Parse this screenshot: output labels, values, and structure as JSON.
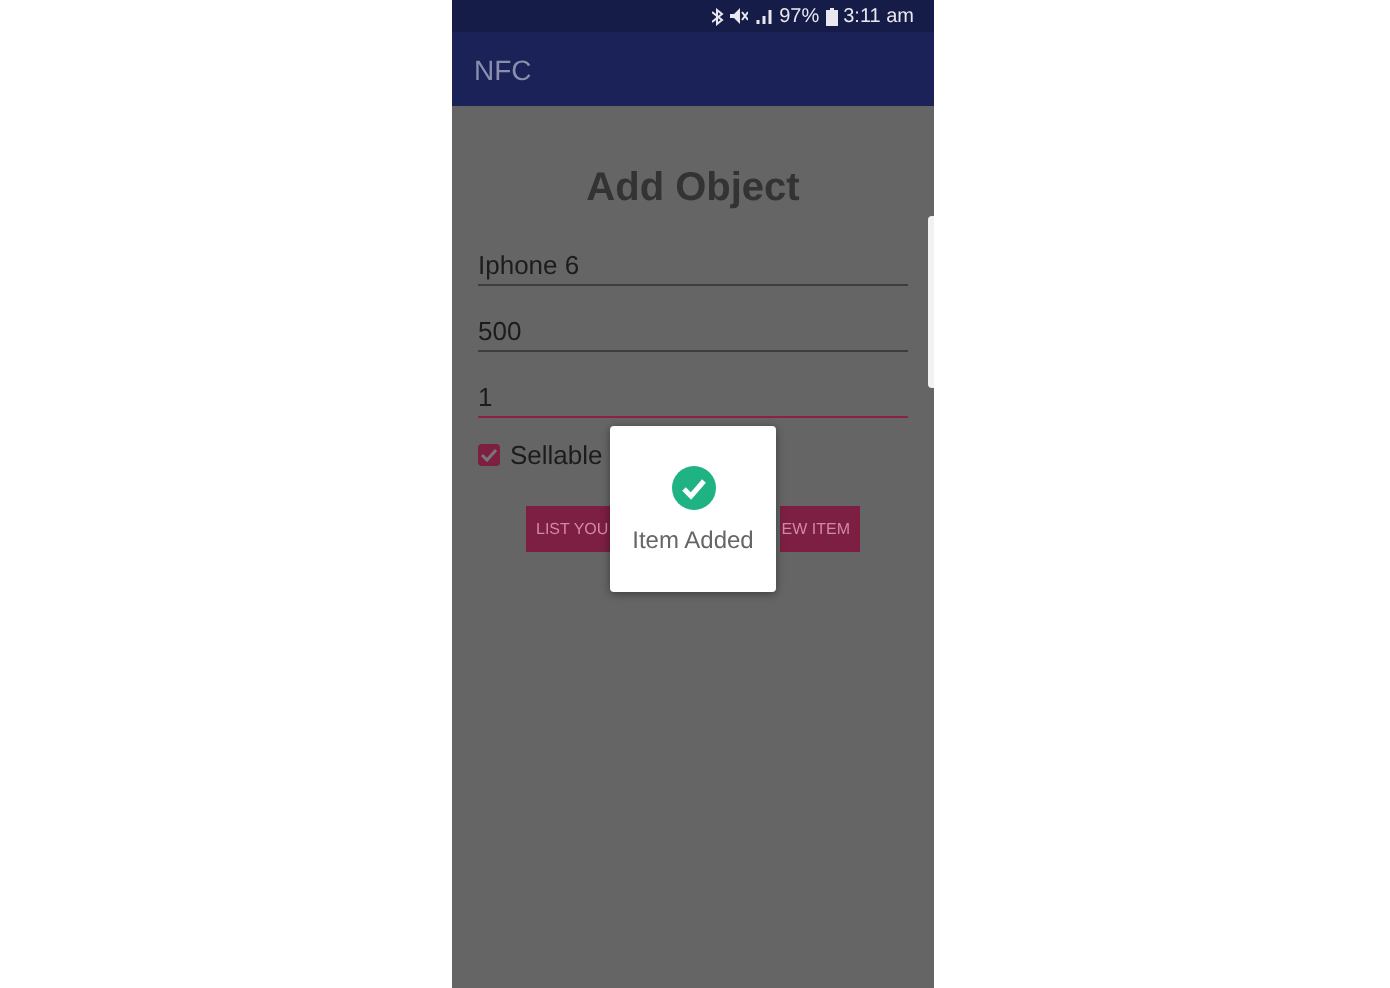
{
  "status_bar": {
    "battery": "97%",
    "time": "3:11 am"
  },
  "app_bar": {
    "title": "NFC"
  },
  "form": {
    "heading": "Add Object",
    "fields": [
      {
        "value": "Iphone 6",
        "focused": false
      },
      {
        "value": "500",
        "focused": false
      },
      {
        "value": "1",
        "focused": true
      }
    ],
    "checkbox": {
      "label": "Sellable",
      "checked": true
    },
    "buttons": [
      "LIST YOU",
      "EW ITEM"
    ]
  },
  "toast": {
    "message": "Item Added"
  }
}
